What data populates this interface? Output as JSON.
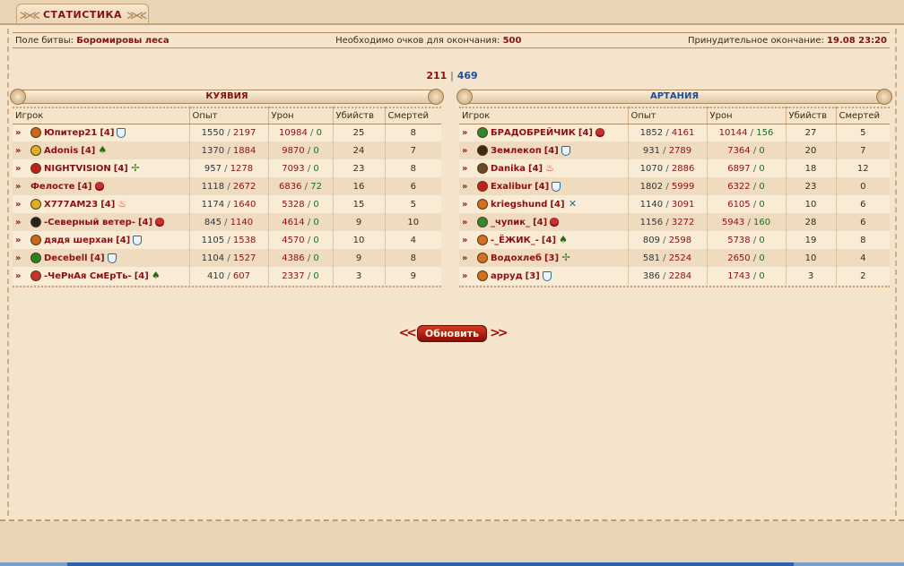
{
  "tab": {
    "title": "СТАТИСТИКА"
  },
  "info": {
    "battlefield_label": "Поле битвы:",
    "battlefield_value": "Боромировы леса",
    "points_label": "Необходимо очков для окончания:",
    "points_value": "500",
    "end_label": "Принудительное окончание:",
    "end_value": "19.08 23:20"
  },
  "score": {
    "left": "211",
    "separator": "|",
    "right": "469"
  },
  "columns": [
    "Игрок",
    "Опыт",
    "Урон",
    "Убийств",
    "Смертей"
  ],
  "teams": [
    {
      "name": "КУЯВИЯ",
      "color": "#8a1010",
      "players": [
        {
          "name": "Юпитер21",
          "level": "[4]",
          "clan_icon": "orange-drop-icon",
          "clan_color": "#c8661a",
          "rank_icon": "shield-icon",
          "exp_a": "1550",
          "exp_b": "2197",
          "dmg_a": "10984",
          "dmg_b": "0",
          "kills": "25",
          "deaths": "8"
        },
        {
          "name": "Adonis",
          "level": "[4]",
          "clan_icon": "lightning-emblem-icon",
          "clan_color": "#e0b020",
          "rank_icon": "tree-icon",
          "exp_a": "1370",
          "exp_b": "1884",
          "dmg_a": "9870",
          "dmg_b": "0",
          "kills": "24",
          "deaths": "7"
        },
        {
          "name": "NIGHTVISION",
          "level": "[4]",
          "clan_icon": "spartan-helmet-icon",
          "clan_color": "#c02020",
          "rank_icon": "cross-icon",
          "exp_a": "957",
          "exp_b": "1278",
          "dmg_a": "7093",
          "dmg_b": "0",
          "kills": "23",
          "deaths": "8"
        },
        {
          "name": "Фелосте",
          "level": "[4]",
          "clan_icon": "",
          "clan_color": "",
          "rank_icon": "skull-icon",
          "exp_a": "1118",
          "exp_b": "2672",
          "dmg_a": "6836",
          "dmg_b": "72",
          "kills": "16",
          "deaths": "6"
        },
        {
          "name": "X777AM23",
          "level": "[4]",
          "clan_icon": "lightning-emblem-icon",
          "clan_color": "#e0b020",
          "rank_icon": "fire-icon",
          "exp_a": "1174",
          "exp_b": "1640",
          "dmg_a": "5328",
          "dmg_b": "0",
          "kills": "15",
          "deaths": "5"
        },
        {
          "name": "-Северный ветер-",
          "level": "[4]",
          "clan_icon": "feather-icon",
          "clan_color": "#222222",
          "rank_icon": "skull-icon",
          "exp_a": "845",
          "exp_b": "1140",
          "dmg_a": "4614",
          "dmg_b": "0",
          "kills": "9",
          "deaths": "10"
        },
        {
          "name": "дядя шерхан",
          "level": "[4]",
          "clan_icon": "orange-drop-icon",
          "clan_color": "#c8661a",
          "rank_icon": "shield-icon",
          "exp_a": "1105",
          "exp_b": "1538",
          "dmg_a": "4570",
          "dmg_b": "0",
          "kills": "10",
          "deaths": "4"
        },
        {
          "name": "Decebell",
          "level": "[4]",
          "clan_icon": "green-shield-icon",
          "clan_color": "#1e8a1e",
          "rank_icon": "shield-icon",
          "exp_a": "1104",
          "exp_b": "1527",
          "dmg_a": "4386",
          "dmg_b": "0",
          "kills": "9",
          "deaths": "8"
        },
        {
          "name": "-ЧеРнАя СмЕрТь-",
          "level": "[4]",
          "clan_icon": "crest-icon",
          "clan_color": "#c83030",
          "rank_icon": "tree-icon",
          "exp_a": "410",
          "exp_b": "607",
          "dmg_a": "2337",
          "dmg_b": "0",
          "kills": "3",
          "deaths": "9"
        }
      ]
    },
    {
      "name": "АРТАНИЯ",
      "color": "#1c4fa0",
      "players": [
        {
          "name": "БРАДОБРЕЙЧИК",
          "level": "[4]",
          "clan_icon": "green-emblem-icon",
          "clan_color": "#2e8a2e",
          "rank_icon": "skull-icon",
          "exp_a": "1852",
          "exp_b": "4161",
          "dmg_a": "10144",
          "dmg_b": "156",
          "kills": "27",
          "deaths": "5"
        },
        {
          "name": "Землекоп",
          "level": "[4]",
          "clan_icon": "crown-icon",
          "clan_color": "#3a2a14",
          "rank_icon": "shield-icon",
          "exp_a": "931",
          "exp_b": "2789",
          "dmg_a": "7364",
          "dmg_b": "0",
          "kills": "20",
          "deaths": "7"
        },
        {
          "name": "Danika",
          "level": "[4]",
          "clan_icon": "cross-emblem-icon",
          "clan_color": "#6a4a2a",
          "rank_icon": "fire-icon",
          "exp_a": "1070",
          "exp_b": "2886",
          "dmg_a": "6897",
          "dmg_b": "0",
          "kills": "18",
          "deaths": "12"
        },
        {
          "name": "Exalibur",
          "level": "[4]",
          "clan_icon": "red-shield-icon",
          "clan_color": "#c02020",
          "rank_icon": "shield-icon",
          "exp_a": "1802",
          "exp_b": "5999",
          "dmg_a": "6322",
          "dmg_b": "0",
          "kills": "23",
          "deaths": "0"
        },
        {
          "name": "kriegshund",
          "level": "[4]",
          "clan_icon": "orange-emblem-icon",
          "clan_color": "#d07020",
          "rank_icon": "swords-icon",
          "exp_a": "1140",
          "exp_b": "3091",
          "dmg_a": "6105",
          "dmg_b": "0",
          "kills": "10",
          "deaths": "6"
        },
        {
          "name": "_чупик_",
          "level": "[4]",
          "clan_icon": "green-emblem-icon",
          "clan_color": "#2e8a2e",
          "rank_icon": "skull-icon",
          "exp_a": "1156",
          "exp_b": "3272",
          "dmg_a": "5943",
          "dmg_b": "160",
          "kills": "28",
          "deaths": "6"
        },
        {
          "name": "-_ЁЖИК_-",
          "level": "[4]",
          "clan_icon": "orange-emblem-icon",
          "clan_color": "#d07020",
          "rank_icon": "tree-icon",
          "exp_a": "809",
          "exp_b": "2598",
          "dmg_a": "5738",
          "dmg_b": "0",
          "kills": "19",
          "deaths": "8"
        },
        {
          "name": "Водохлеб",
          "level": "[3]",
          "clan_icon": "orange-emblem-icon",
          "clan_color": "#d07020",
          "rank_icon": "cross-icon",
          "exp_a": "581",
          "exp_b": "2524",
          "dmg_a": "2650",
          "dmg_b": "0",
          "kills": "10",
          "deaths": "4"
        },
        {
          "name": "арруд",
          "level": "[3]",
          "clan_icon": "orange-emblem-icon",
          "clan_color": "#d07020",
          "rank_icon": "shield-icon",
          "exp_a": "386",
          "exp_b": "2284",
          "dmg_a": "1743",
          "dmg_b": "0",
          "kills": "3",
          "deaths": "2"
        }
      ]
    }
  ],
  "refresh_label": "Обновить"
}
